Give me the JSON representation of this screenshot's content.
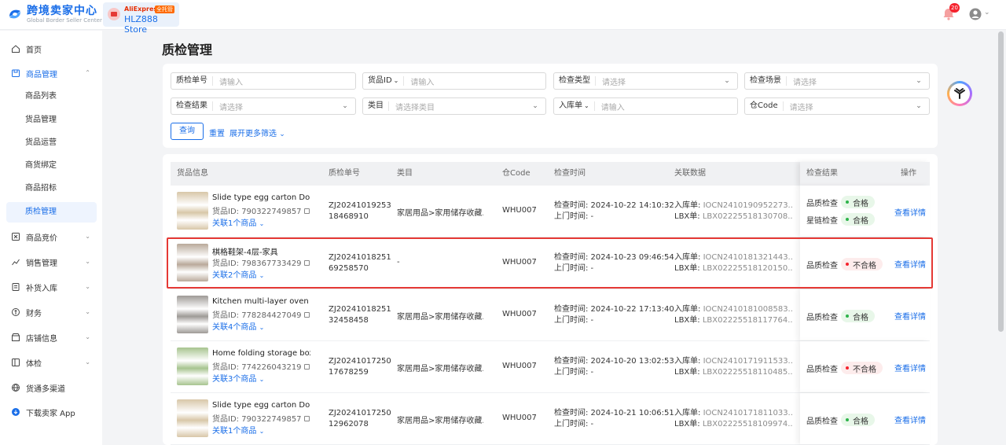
{
  "brand": {
    "title": "跨境卖家中心",
    "subtitle": "Global Border Seller Center"
  },
  "store": {
    "platform": "AliExpress",
    "tag": "全托管",
    "name": "HLZ888 Store"
  },
  "notifications": {
    "count": "20"
  },
  "sidebar": {
    "items": [
      {
        "label": "首页",
        "icon": "home-icon"
      },
      {
        "label": "商品管理",
        "icon": "box-icon",
        "open": true
      },
      {
        "label": "商品竞价",
        "icon": "bid-icon"
      },
      {
        "label": "销售管理",
        "icon": "sales-icon"
      },
      {
        "label": "补货入库",
        "icon": "restock-icon"
      },
      {
        "label": "财务",
        "icon": "finance-icon"
      },
      {
        "label": "店铺信息",
        "icon": "shop-icon"
      },
      {
        "label": "体检",
        "icon": "checkup-icon"
      },
      {
        "label": "货通多渠道",
        "icon": "globe-icon"
      },
      {
        "label": "下载卖家 App",
        "icon": "download-icon"
      }
    ],
    "sub_items": [
      "商品列表",
      "货品管理",
      "货品运营",
      "商货绑定",
      "商品招标",
      "质检管理"
    ]
  },
  "page": {
    "title": "质检管理"
  },
  "filters": {
    "qc_no": {
      "label": "质检单号",
      "placeholder": "请输入"
    },
    "goods_id": {
      "label": "货品ID",
      "placeholder": "请输入"
    },
    "check_type": {
      "label": "检查类型",
      "placeholder": "请选择"
    },
    "check_scene": {
      "label": "检查场景",
      "placeholder": "请选择"
    },
    "check_result": {
      "label": "检查结果",
      "placeholder": "请选择"
    },
    "category": {
      "label": "类目",
      "placeholder": "请选择类目"
    },
    "inbound": {
      "label": "入库单",
      "placeholder": "请输入"
    },
    "warehouse": {
      "label": "仓Code",
      "placeholder": "请选择"
    },
    "query": "查询",
    "reset": "重置",
    "more": "展开更多筛选"
  },
  "table": {
    "headers": [
      "货品信息",
      "质检单号",
      "类目",
      "仓Code",
      "检查时间",
      "关联数据",
      "检查结果",
      "操作"
    ],
    "rows": [
      {
        "name": "Slide type egg carton Dou...",
        "goods_id": "货品ID: 790322749857",
        "link": "关联1个商品",
        "qc1": "ZJ20241019253",
        "qc2": "18468910",
        "category": "家居用品>家用储存收藏...",
        "wh": "WHU007",
        "check_time": "检查时间:  2024-10-22 14:10:32",
        "visit_time": "上门时间:  -",
        "inbound_k": "入库单:",
        "inbound_v": "IOCN2410190952273...",
        "lbx_k": "LBX单:",
        "lbx_v": "LBX02225518130708...",
        "r1_label": "品质检查",
        "r1_val": "合格",
        "r1_ok": true,
        "r2_label": "星链检查",
        "r2_val": "合格",
        "r2_ok": true,
        "action": "查看详情",
        "thumb": "#d8c7a8"
      },
      {
        "name": "棋格鞋架-4层-家具",
        "goods_id": "货品ID: 798367733429",
        "link": "关联2个商品",
        "qc1": "ZJ20241018251",
        "qc2": "69258570",
        "category": "-",
        "wh": "WHU007",
        "check_time": "检查时间:  2024-10-23 09:46:54",
        "visit_time": "上门时间:  -",
        "inbound_k": "入库单:",
        "inbound_v": "IOCN2410181321443...",
        "lbx_k": "LBX单:",
        "lbx_v": "LBX02225518120150...",
        "r1_label": "品质检查",
        "r1_val": "不合格",
        "r1_ok": false,
        "action": "查看详情",
        "thumb": "#b9a99a"
      },
      {
        "name": "Kitchen multi-layer oven r...",
        "goods_id": "货品ID: 778284427049",
        "link": "关联4个商品",
        "qc1": "ZJ20241018251",
        "qc2": "32458458",
        "category": "家居用品>家用储存收藏...",
        "wh": "WHU007",
        "check_time": "检查时间:  2024-10-22 17:13:40",
        "visit_time": "上门时间:  -",
        "inbound_k": "入库单:",
        "inbound_v": "IOCN2410181008583...",
        "lbx_k": "LBX单:",
        "lbx_v": "LBX02225518117764...",
        "r1_label": "品质检查",
        "r1_val": "合格",
        "r1_ok": true,
        "action": "查看详情",
        "thumb": "#9e9a96"
      },
      {
        "name": "Home folding storage box ...",
        "goods_id": "货品ID: 774226043219",
        "link": "关联3个商品",
        "qc1": "ZJ20241017250",
        "qc2": "17678259",
        "category": "家居用品>家用储存收藏...",
        "wh": "WHU007",
        "check_time": "检查时间:  2024-10-20 13:02:53",
        "visit_time": "上门时间:  -",
        "inbound_k": "入库单:",
        "inbound_v": "IOCN2410171911533...",
        "lbx_k": "LBX单:",
        "lbx_v": "LBX02225518110485...",
        "r1_label": "品质检查",
        "r1_val": "不合格",
        "r1_ok": false,
        "action": "查看详情",
        "thumb": "#a7c48f"
      },
      {
        "name": "Slide type egg carton Dou...",
        "goods_id": "货品ID: 790322749857",
        "link": "关联1个商品",
        "qc1": "ZJ20241017250",
        "qc2": "12962078",
        "category": "家居用品>家用储存收藏...",
        "wh": "WHU007",
        "check_time": "检查时间:  2024-10-21 10:06:51",
        "visit_time": "上门时间:  -",
        "inbound_k": "入库单:",
        "inbound_v": "IOCN2410171811033...",
        "lbx_k": "LBX单:",
        "lbx_v": "LBX02225518109974...",
        "r1_label": "品质检查",
        "r1_val": "合格",
        "r1_ok": true,
        "action": "查看详情",
        "thumb": "#d8c7a8"
      }
    ]
  },
  "colors": {
    "accent": "#1a6ee8",
    "ok": "#2db34a",
    "bad": "#f5222d",
    "highlight": "#e53935"
  }
}
